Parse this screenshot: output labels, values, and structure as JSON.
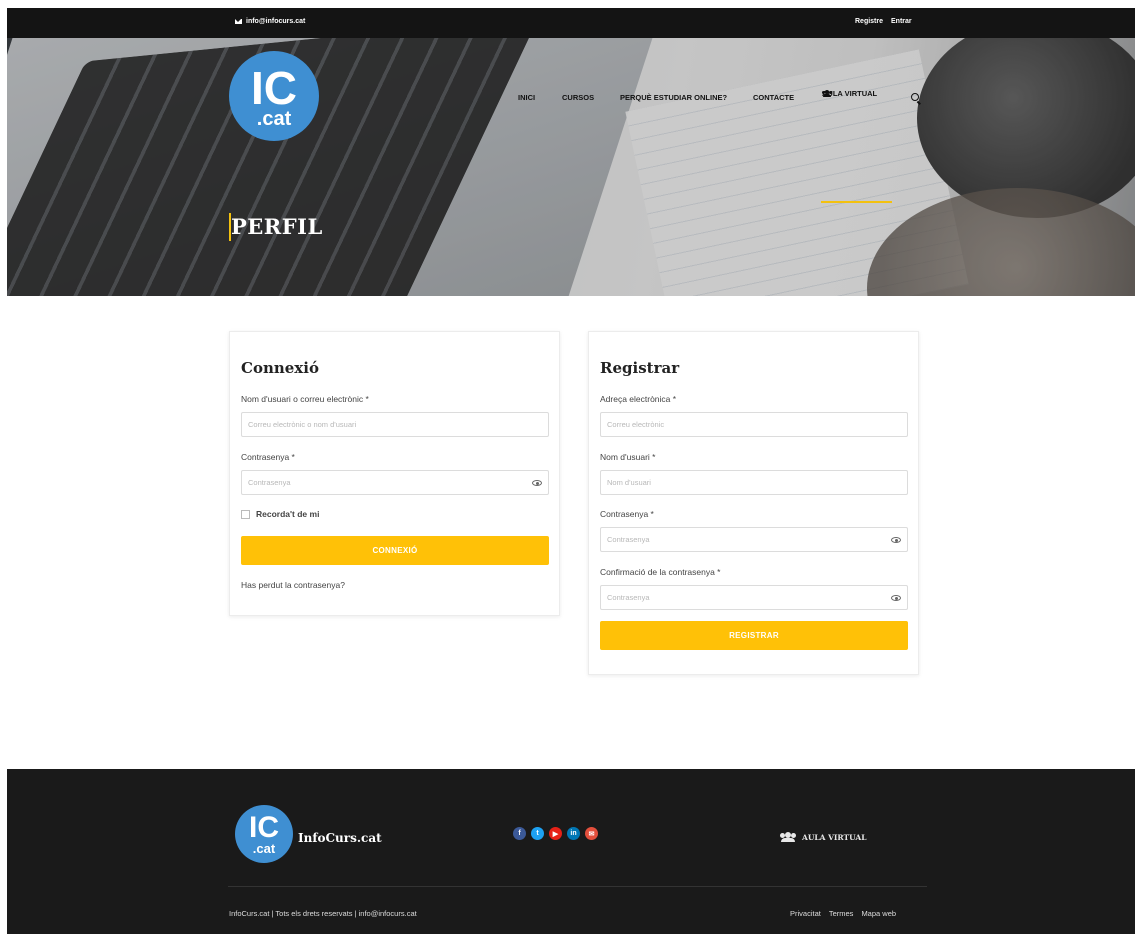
{
  "topbar": {
    "email": "info@infocurs.cat",
    "register": "Registre",
    "login": "Entrar"
  },
  "logo": {
    "big": "IC",
    "small": ".cat"
  },
  "nav": {
    "items": [
      "INICI",
      "CURSOS",
      "PERQUÈ ESTUDIAR ONLINE?",
      "CONTACTE"
    ],
    "aula": "AULA VIRTUAL"
  },
  "hero": {
    "title": "PERFIL"
  },
  "login": {
    "title": "Connexió",
    "user_label": "Nom d'usuari o correu electrònic *",
    "user_placeholder": "Correu electrònic o nom d'usuari",
    "pass_label": "Contrasenya *",
    "pass_placeholder": "Contrasenya",
    "remember": "Recorda't de mi",
    "button": "CONNEXIÓ",
    "lost": "Has perdut la contrasenya?"
  },
  "register": {
    "title": "Registrar",
    "email_label": "Adreça electrònica *",
    "email_placeholder": "Correu electrònic",
    "user_label": "Nom d'usuari *",
    "user_placeholder": "Nom d'usuari",
    "pass_label": "Contrasenya *",
    "pass_placeholder": "Contrasenya",
    "confirm_label": "Confirmació de la contrasenya *",
    "confirm_placeholder": "Contrasenya",
    "button": "REGISTRAR"
  },
  "footer": {
    "brand": "InfoCurs.cat",
    "aula": "AULA VIRTUAL",
    "copyright": "InfoCurs.cat | Tots els drets reservats | info@infocurs.cat",
    "links": [
      "Privacitat",
      "Termes",
      "Mapa web"
    ],
    "socials": [
      {
        "icon": "facebook-icon",
        "glyph": "f",
        "color": "#3b5998"
      },
      {
        "icon": "twitter-icon",
        "glyph": "t",
        "color": "#1da1f2"
      },
      {
        "icon": "youtube-icon",
        "glyph": "▶",
        "color": "#e62117"
      },
      {
        "icon": "linkedin-icon",
        "glyph": "in",
        "color": "#0077b5"
      },
      {
        "icon": "mail-icon",
        "glyph": "✉",
        "color": "#e34f3c"
      }
    ]
  },
  "colors": {
    "accent": "#ffc107",
    "logo_blue": "#3f8fd2",
    "dark": "#141414"
  }
}
